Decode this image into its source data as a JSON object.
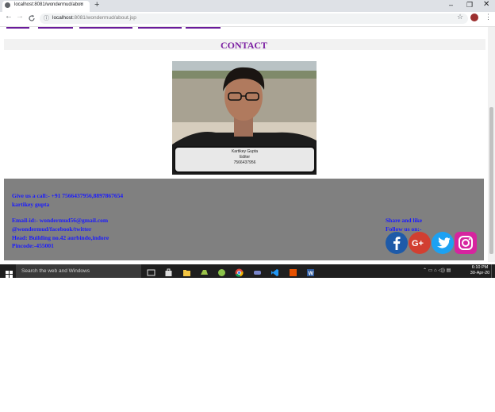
{
  "browser": {
    "tab_title": "localhost:8081/wondermud/abou",
    "tab_close": "×",
    "new_tab": "+",
    "url_host": "localhost",
    "url_rest": ":8081/wondermud/about.jsp",
    "back": "←",
    "forward": "→",
    "reload": "C",
    "star": "☆",
    "menu": "⋮",
    "min": "–",
    "max": "❐",
    "close": "✕"
  },
  "page": {
    "contact_title": "CONTACT",
    "person": {
      "name": "Kartikey Gupta",
      "role": "Editer",
      "phone": "7566437956"
    },
    "footer": {
      "call": "Give us a call:- +91 7566437956,8897867654",
      "name": "kartikey gupta",
      "email": "Email-id:- wondermud56@gmail.com",
      "social_handle": "@wondermud/facebook/twitter",
      "address": "Head: Building no.42 aurbindo,indore",
      "pincode": "Pincode:-455001",
      "share": "Share and like",
      "follow": "Follow us on:-",
      "social_icons": [
        "facebook-icon",
        "google-plus-icon",
        "twitter-icon",
        "instagram-icon"
      ]
    }
  },
  "taskbar": {
    "search_placeholder": "Search the web and Windows",
    "time": "6:10 PM",
    "date": "30-Apr-20"
  },
  "colors": {
    "title": "#7b1fa2",
    "footer_bg": "#808080",
    "footer_text": "#1a1aff",
    "nav_underline": "#6a1b9a"
  }
}
